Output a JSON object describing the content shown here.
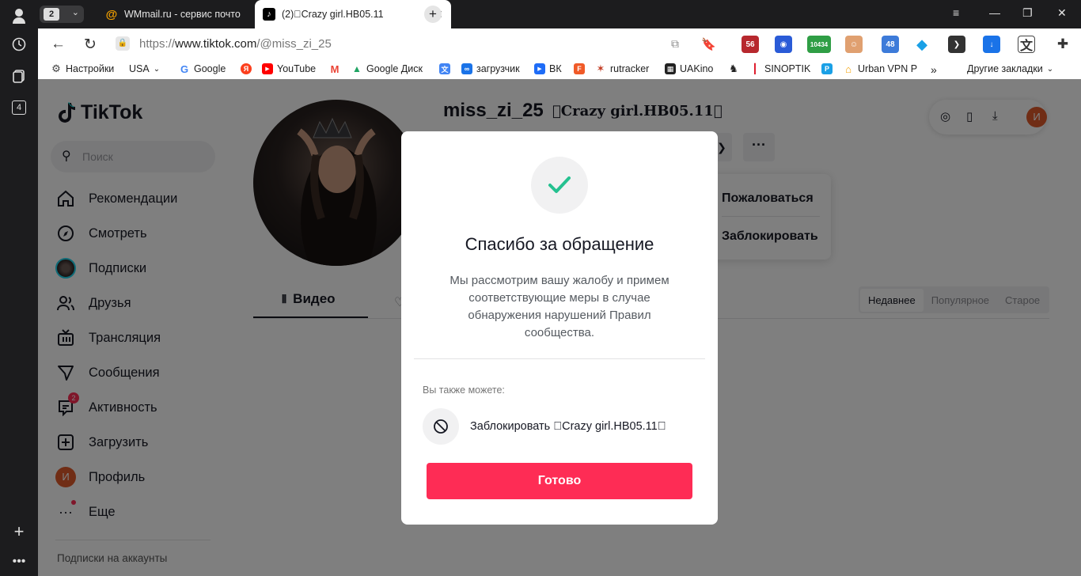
{
  "browser": {
    "tab_count": "2",
    "tabs": [
      {
        "title": "WMmail.ru - сервис почто",
        "favicon": "wmmail"
      },
      {
        "title": "(2)\u0000Crazy girl.HB05.11",
        "favicon": "tiktok"
      }
    ],
    "window_controls": {
      "menu": "≡",
      "minimize": "—",
      "restore": "❐",
      "close": "✕"
    }
  },
  "address_bar": {
    "url_prefix": "https://",
    "url_host": "www.tiktok.com",
    "url_path": "/@miss_zi_25",
    "extensions": [
      {
        "name": "ext-badge-56",
        "label": "56",
        "color": "#b7282e"
      },
      {
        "name": "ext-vpn-flag",
        "label": "",
        "color": "#2a5bd7"
      },
      {
        "name": "ext-counter-10434",
        "label": "10434",
        "color": "#2f9e45"
      },
      {
        "name": "ext-char",
        "label": "",
        "color": "#e0a070"
      },
      {
        "name": "ext-badge-48",
        "label": "48",
        "color": "#3d7bd9"
      },
      {
        "name": "ext-gem",
        "label": "",
        "color": "#1aa0e6"
      },
      {
        "name": "ext-arrow",
        "label": "",
        "color": "#333333"
      },
      {
        "name": "ext-download",
        "label": "",
        "color": "#1a73e8"
      },
      {
        "name": "ext-translate",
        "label": "",
        "color": "#444444"
      },
      {
        "name": "ext-puzzle",
        "label": "",
        "color": "#333333"
      }
    ]
  },
  "bookmarks": [
    {
      "label": "Настройки",
      "icon": "gear-icon",
      "color": "#444"
    },
    {
      "label": "USA",
      "icon": "",
      "color": ""
    },
    {
      "label": "Google",
      "icon": "G",
      "color": "#4285f4"
    },
    {
      "label": "",
      "icon": "Я",
      "color": "#fc3f1d"
    },
    {
      "label": "YouTube",
      "icon": "▶",
      "color": "#ff0000"
    },
    {
      "label": "",
      "icon": "M",
      "color": "#ea4335"
    },
    {
      "label": "Google Диск",
      "icon": "▲",
      "color": "#1fa463"
    },
    {
      "label": "",
      "icon": "文",
      "color": "#4285f4"
    },
    {
      "label": "загрузчик",
      "icon": "∞",
      "color": "#1a73e8"
    },
    {
      "label": "ВК",
      "icon": "▶",
      "color": "#1e6cf7"
    },
    {
      "label": "",
      "icon": "F",
      "color": "#f05a28"
    },
    {
      "label": "rutracker",
      "icon": "✶",
      "color": "#c23b22"
    },
    {
      "label": "UAKino",
      "icon": "▦",
      "color": "#222"
    },
    {
      "label": "",
      "icon": "♞",
      "color": "#222"
    },
    {
      "label": "SINOPTIK",
      "icon": "🌡",
      "color": "#d12"
    },
    {
      "label": "",
      "icon": "P",
      "color": "#1aa0e6"
    },
    {
      "label": "Urban VPN P",
      "icon": "⌂",
      "color": "#f4a100"
    },
    {
      "label": "»",
      "icon": "",
      "color": ""
    },
    {
      "label": "Другие закладки",
      "icon": "",
      "color": ""
    }
  ],
  "tiktok": {
    "logo": "TikTok",
    "search_placeholder": "Поиск",
    "nav": [
      {
        "label": "Рекомендации",
        "icon": "home-icon"
      },
      {
        "label": "Смотреть",
        "icon": "compass-icon"
      },
      {
        "label": "Подписки",
        "icon": "avatar-icon"
      },
      {
        "label": "Друзья",
        "icon": "friends-icon"
      },
      {
        "label": "Трансляция",
        "icon": "live-icon"
      },
      {
        "label": "Сообщения",
        "icon": "send-icon"
      },
      {
        "label": "Активность",
        "icon": "activity-icon",
        "badge": "2"
      },
      {
        "label": "Загрузить",
        "icon": "upload-icon"
      },
      {
        "label": "Профиль",
        "icon": "profile-icon",
        "avatar_letter": "И"
      },
      {
        "label": "Еще",
        "icon": "more-icon"
      }
    ],
    "subs_accounts": "Подписки на аккаунты",
    "profile": {
      "username": "miss_zi_25",
      "nickname": "\u0000Crazy girl.HB05.11\u0000"
    },
    "menu": {
      "report": "Пожаловаться",
      "block": "Заблокировать"
    },
    "me_letter": "И",
    "tabs": {
      "videos": "Видео"
    },
    "sort": [
      "Недавнее",
      "Популярное",
      "Старое"
    ]
  },
  "modal": {
    "title": "Спасибо за обращение",
    "body": "Мы рассмотрим вашу жалобу и примем соответствующие меры в случае обнаружения нарушений Правил сообщества.",
    "also_label": "Вы также можете:",
    "block_label": "Заблокировать \u0000Crazy girl.HB05.11\u0000",
    "done_label": "Готово"
  },
  "colors": {
    "accent": "#fe2c55",
    "check": "#25c190",
    "text": "#161823"
  }
}
